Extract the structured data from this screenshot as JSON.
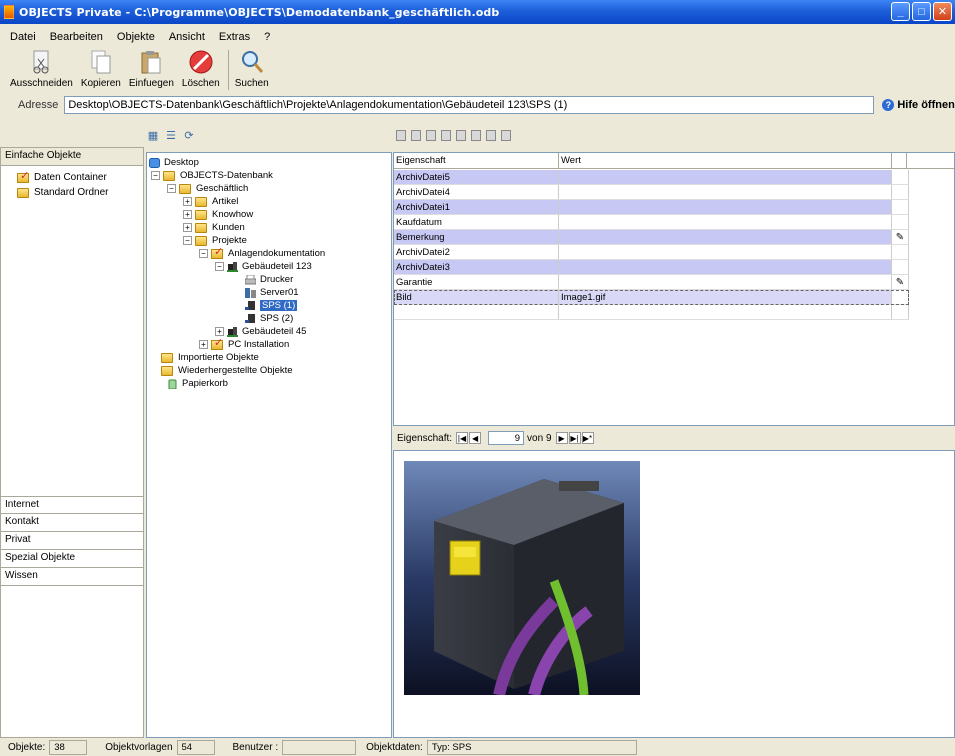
{
  "window": {
    "title": "OBJECTS Private - C:\\Programme\\OBJECTS\\Demodatenbank_geschäftlich.odb",
    "buttons": [
      "minimize",
      "maximize",
      "close"
    ]
  },
  "menu": [
    "Datei",
    "Bearbeiten",
    "Objekte",
    "Ansicht",
    "Extras",
    "?"
  ],
  "toolbar": [
    {
      "label": "Ausschneiden",
      "icon": "cut-icon"
    },
    {
      "label": "Kopieren",
      "icon": "copy-icon"
    },
    {
      "label": "Einfuegen",
      "icon": "paste-icon"
    },
    {
      "label": "Löschen",
      "icon": "delete-icon"
    },
    {
      "label": "Suchen",
      "icon": "search-icon"
    }
  ],
  "address": {
    "label": "Adresse",
    "value": "Desktop\\OBJECTS-Datenbank\\Geschäftlich\\Projekte\\Anlagendokumentation\\Gebäudeteil 123\\SPS (1)",
    "help": "Hife öffnen"
  },
  "categories": {
    "top_header": "Einfache Objekte",
    "items": [
      {
        "label": "Daten Container",
        "icon": "checked-folder-icon"
      },
      {
        "label": "Standard Ordner",
        "icon": "folder-icon"
      }
    ],
    "bottom": [
      "Internet",
      "Kontakt",
      "Privat",
      "Spezial Objekte",
      "Wissen"
    ]
  },
  "tree": [
    {
      "label": "Desktop",
      "icon": "desktop-icon",
      "level": 0,
      "expander": ""
    },
    {
      "label": "OBJECTS-Datenbank",
      "icon": "folder-icon",
      "level": 1,
      "expander": "−"
    },
    {
      "label": "Geschäftlich",
      "icon": "folder-icon",
      "level": 2,
      "expander": "−"
    },
    {
      "label": "Artikel",
      "icon": "folder-icon",
      "level": 3,
      "expander": "+"
    },
    {
      "label": "Knowhow",
      "icon": "folder-icon",
      "level": 3,
      "expander": "+"
    },
    {
      "label": "Kunden",
      "icon": "folder-icon",
      "level": 3,
      "expander": "+"
    },
    {
      "label": "Projekte",
      "icon": "folder-icon",
      "level": 3,
      "expander": "−"
    },
    {
      "label": "Anlagendokumentation",
      "icon": "checked-folder-icon",
      "level": 4,
      "expander": "−"
    },
    {
      "label": "Gebäudeteil 123",
      "icon": "building-icon",
      "level": 5,
      "expander": "−"
    },
    {
      "label": "Drucker",
      "icon": "printer-icon",
      "level": 6,
      "expander": ""
    },
    {
      "label": "Server01",
      "icon": "server-icon",
      "level": 6,
      "expander": ""
    },
    {
      "label": "SPS (1)",
      "icon": "device-icon",
      "level": 6,
      "expander": "",
      "selected": true
    },
    {
      "label": "SPS (2)",
      "icon": "device-icon",
      "level": 6,
      "expander": ""
    },
    {
      "label": "Gebäudeteil 45",
      "icon": "building-icon",
      "level": 5,
      "expander": "+"
    },
    {
      "label": "PC Installation",
      "icon": "checked-folder-icon",
      "level": 4,
      "expander": "+"
    },
    {
      "label": "Importierte Objekte",
      "icon": "folder-icon",
      "level": 1,
      "expander": ""
    },
    {
      "label": "Wiederhergestellte Objekte",
      "icon": "folder-icon",
      "level": 1,
      "expander": ""
    },
    {
      "label": "Papierkorb",
      "icon": "recycle-bin-icon",
      "level": 1,
      "expander": ""
    }
  ],
  "grid": {
    "headers": [
      "Eigenschaft",
      "Wert"
    ],
    "rows": [
      {
        "name": "ArchivDatei5",
        "value": "",
        "icon": ""
      },
      {
        "name": "ArchivDatei4",
        "value": "",
        "icon": ""
      },
      {
        "name": "ArchivDatei1",
        "value": "",
        "icon": ""
      },
      {
        "name": "Kaufdatum",
        "value": "",
        "icon": ""
      },
      {
        "name": "Bemerkung",
        "value": "",
        "icon": "edit-note-icon"
      },
      {
        "name": "ArchivDatei2",
        "value": "",
        "icon": ""
      },
      {
        "name": "ArchivDatei3",
        "value": "",
        "icon": ""
      },
      {
        "name": "Garantie",
        "value": "",
        "icon": "edit-note-icon"
      },
      {
        "name": "Bild",
        "value": "Image1.gif",
        "icon": ""
      }
    ]
  },
  "navigator": {
    "label": "Eigenschaft:",
    "current": "9",
    "of_text": "von 9"
  },
  "status": {
    "objekte_label": "Objekte:",
    "objekte_value": "38",
    "vorlagen_label": "Objektvorlagen",
    "vorlagen_value": "54",
    "benutzer_label": "Benutzer :",
    "benutzer_value": "",
    "objektdaten_label": "Objektdaten:",
    "objektdaten_value": "Typ: SPS"
  }
}
